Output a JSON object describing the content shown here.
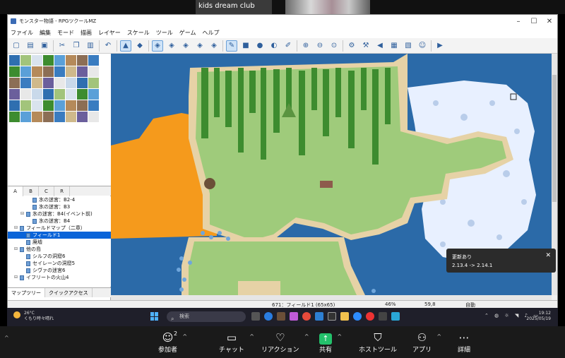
{
  "meeting": {
    "participant_name": "kids dream club"
  },
  "window": {
    "title": "モンスター物語 - RPGツクールMZ",
    "menu": [
      "ファイル",
      "編集",
      "モード",
      "描画",
      "レイヤー",
      "スケール",
      "ツール",
      "ゲーム",
      "ヘルプ"
    ]
  },
  "tileset_tabs": [
    "A",
    "B",
    "C",
    "R"
  ],
  "map_tree": [
    {
      "label": "氷の迷宮：B2-4",
      "indent": 3,
      "expand": ""
    },
    {
      "label": "氷の迷宮：B3",
      "indent": 3,
      "expand": ""
    },
    {
      "label": "氷の迷宮：B4(イベント前)",
      "indent": 2,
      "expand": "⊟"
    },
    {
      "label": "氷の迷宮：B4",
      "indent": 3,
      "expand": ""
    },
    {
      "label": "フィールドマップ（二章）",
      "indent": 1,
      "expand": "⊟"
    },
    {
      "label": "フィールド1",
      "indent": 2,
      "expand": "",
      "selected": true
    },
    {
      "label": "廃墟",
      "indent": 2,
      "expand": ""
    },
    {
      "label": "他の島",
      "indent": 1,
      "expand": "⊟"
    },
    {
      "label": "シルフの洞窟6",
      "indent": 2,
      "expand": ""
    },
    {
      "label": "セイレーンの洞窟5",
      "indent": 2,
      "expand": ""
    },
    {
      "label": "シヴァの迷宮6",
      "indent": 2,
      "expand": ""
    },
    {
      "label": "イフリートの火山4",
      "indent": 1,
      "expand": "⊟"
    }
  ],
  "bottom_tabs": [
    "マップツリー",
    "クイックアクセス"
  ],
  "status": {
    "map": "671：フィールド1 (65x65)",
    "zoom": "46%",
    "coords": "59,8",
    "mode": "自動"
  },
  "toast": {
    "title": "更新あり",
    "message": "2.13.4 -> 2.14.1"
  },
  "taskbar": {
    "temperature": "26°C",
    "weather": "くもり時々晴れ",
    "search_placeholder": "検索",
    "time": "19:12",
    "date": "2025/05/19"
  },
  "zoom_controls": [
    {
      "label": "参加者",
      "icon": "participants-icon",
      "count": "2"
    },
    {
      "label": "チャット",
      "icon": "chat-icon"
    },
    {
      "label": "リアクション",
      "icon": "reaction-icon"
    },
    {
      "label": "共有",
      "icon": "share-icon"
    },
    {
      "label": "ホストツール",
      "icon": "host-tools-icon"
    },
    {
      "label": "アプリ",
      "icon": "apps-icon"
    },
    {
      "label": "詳細",
      "icon": "more-icon"
    }
  ],
  "colors": {
    "sea": "#2b6aa8",
    "grass": "#9fcb7b",
    "lava": "#f59a1c",
    "sand": "#e6d2a6",
    "ice": "#eef4ff",
    "forest": "#3d8c2f"
  }
}
